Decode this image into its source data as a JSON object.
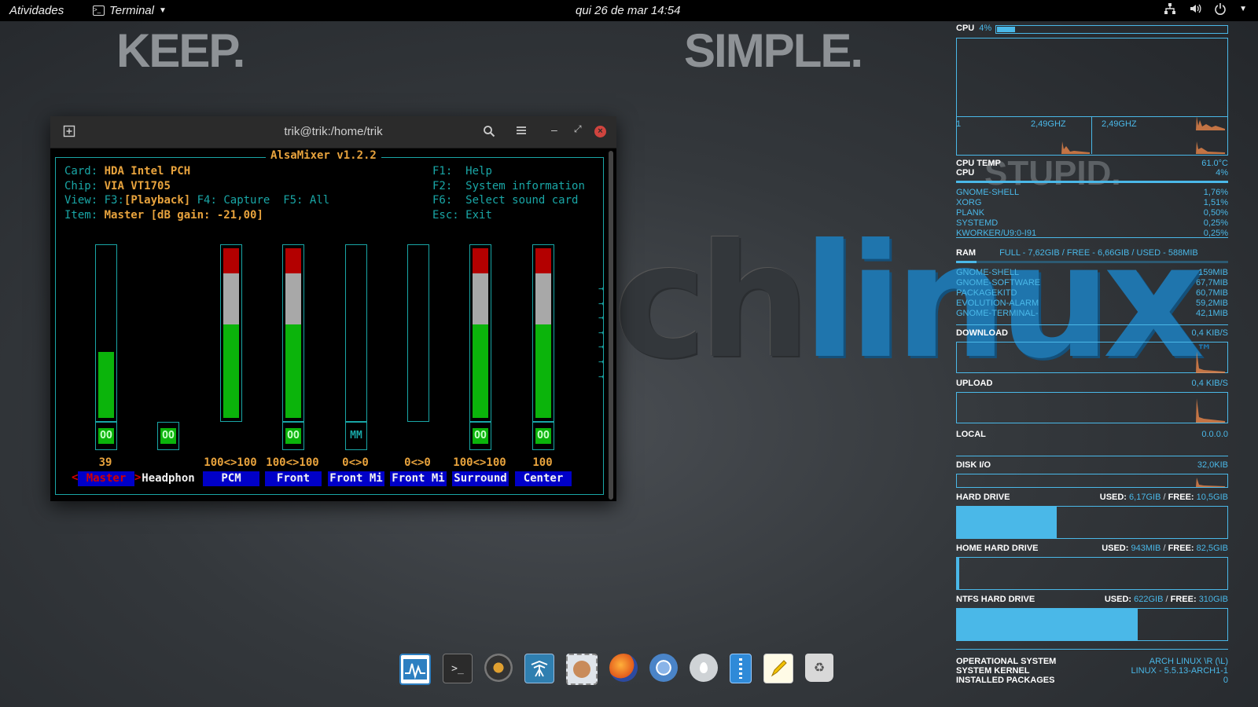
{
  "topbar": {
    "activities": "Atividades",
    "app_name": "Terminal",
    "clock": "qui 26 de mar  14:54"
  },
  "wallpaper": {
    "word1": "KEEP.",
    "word2": "SIMPLE.",
    "word3": "STUPID.",
    "logo_gray": "ch",
    "logo_blue": "linux",
    "logo_tm": "™"
  },
  "terminal": {
    "title": "trik@trik:/home/trik",
    "alsamixer": {
      "title": "AlsaMixer v1.2.2",
      "card_label": "Card:",
      "card": "HDA Intel PCH",
      "chip_label": "Chip:",
      "chip": "VIA VT1705",
      "view_label": "View:",
      "view_f3": "F3:",
      "view_playback": "[Playback]",
      "view_rest": "F4: Capture  F5: All",
      "item_label": "Item:",
      "item": "Master [dB gain: -21,00]",
      "keys": [
        {
          "key": "F1:",
          "desc": "Help"
        },
        {
          "key": "F2:",
          "desc": "System information"
        },
        {
          "key": "F6:",
          "desc": "Select sound card"
        },
        {
          "key": "Esc:",
          "desc": "Exit"
        }
      ],
      "channels": [
        {
          "name": "Master",
          "value": "39",
          "level": 0.39,
          "switch": "OO",
          "selected": true
        },
        {
          "name": "Headphon",
          "value": "",
          "level": null,
          "switch": "OO"
        },
        {
          "name": "PCM",
          "value": "100<>100",
          "level": 1.0,
          "switch": ""
        },
        {
          "name": "Front",
          "value": "100<>100",
          "level": 1.0,
          "switch": "OO"
        },
        {
          "name": "Front Mi",
          "value": "0<>0",
          "level": 0,
          "switch": "MM"
        },
        {
          "name": "Front Mi",
          "value": "0<>0",
          "level": 0,
          "switch": ""
        },
        {
          "name": "Surround",
          "value": "100<>100",
          "level": 1.0,
          "switch": "OO"
        },
        {
          "name": "Center",
          "value": "100",
          "level": 1.0,
          "switch": "OO"
        }
      ],
      "arrows": "→"
    }
  },
  "conky": {
    "cpu_label": "CPU",
    "cpu_pct": "4%",
    "cpu_level": 0.04,
    "core1_id": "1",
    "core1_freq": "2,49GHZ",
    "core2_freq": "2,49GHZ",
    "cpu_temp_label": "CPU TEMP",
    "cpu_temp": "61.0°C",
    "cpu2_label": "CPU",
    "cpu2_pct": "4%",
    "cpu_procs": [
      {
        "name": "GNOME-SHELL",
        "val": "1,76%"
      },
      {
        "name": "XORG",
        "val": "1,51%"
      },
      {
        "name": "PLANK",
        "val": "0,50%"
      },
      {
        "name": "SYSTEMD",
        "val": "0,25%"
      },
      {
        "name": "KWORKER/U9:0-I91",
        "val": "0,25%"
      }
    ],
    "ram_label": "RAM",
    "ram_info": "FULL - 7,62GIB / FREE - 6,66GIB / USED - 588MIB",
    "ram_procs": [
      {
        "name": "GNOME-SHELL",
        "val": "159MIB"
      },
      {
        "name": "GNOME-SOFTWARE",
        "val": "67,7MIB"
      },
      {
        "name": "PACKAGEKITD",
        "val": "60,7MIB"
      },
      {
        "name": "EVOLUTION-ALARM",
        "val": "59,2MIB"
      },
      {
        "name": "GNOME-TERMINAL-",
        "val": "42,1MIB"
      }
    ],
    "download_label": "DOWNLOAD",
    "download_val": "0,4 KIB/S",
    "upload_label": "UPLOAD",
    "upload_val": "0,4 KIB/S",
    "local_label": "LOCAL",
    "local_val": "0.0.0.0",
    "diskio_label": "DISK I/O",
    "diskio_val": "32,0KIB",
    "hdd_label": "HARD DRIVE",
    "hdd_used_label": "USED:",
    "hdd_used": "6,17GIB",
    "hdd_free_label": "FREE:",
    "hdd_free": "10,5GIB",
    "hdd_level": 0.37,
    "home_label": "HOME HARD DRIVE",
    "home_used_label": "USED:",
    "home_used": "943MIB",
    "home_free_label": "FREE:",
    "home_free": "82,5GIB",
    "home_level": 0.01,
    "ntfs_label": "NTFS HARD DRIVE",
    "ntfs_used_label": "USED:",
    "ntfs_used": "622GIB",
    "ntfs_free_label": "FREE:",
    "ntfs_free": "310GIB",
    "ntfs_level": 0.67,
    "os_label": "OPERATIONAL SYSTEM",
    "os_val": "ARCH LINUX \\R (\\L)",
    "kernel_label": "SYSTEM KERNEL",
    "kernel_val": "LINUX - 5.5.13-ARCH1-1",
    "pkgs_label": "INSTALLED PACKAGES",
    "pkgs_val": "0",
    "accent": "#4ab8e8"
  },
  "dock": [
    "system-monitor-icon",
    "terminal-icon",
    "audio-player-icon",
    "network-tool-icon",
    "mail-stamp-icon",
    "firefox-icon",
    "chromium-icon",
    "drop-icon",
    "archive-icon",
    "text-editor-icon",
    "trash-icon"
  ]
}
